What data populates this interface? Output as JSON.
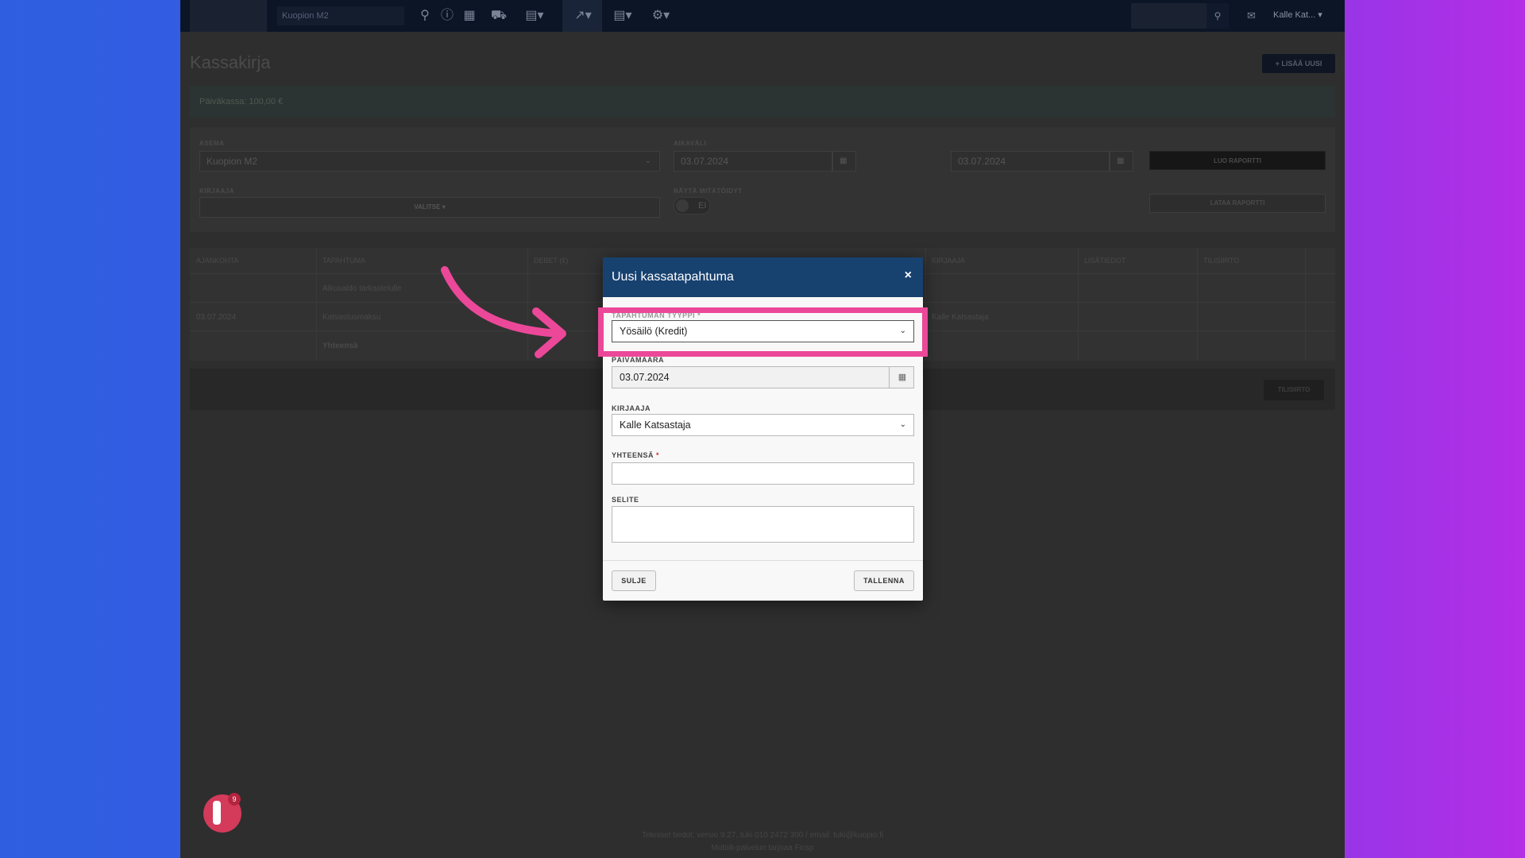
{
  "topbar": {
    "station_value": "Kuopion M2",
    "user_label": "Kalle Kat... ▾"
  },
  "page": {
    "title": "Kassakirja",
    "add_new_label": "+ LISÄÄ UUSI",
    "info_text": "Päiväkassa: 100,00 €"
  },
  "filters": {
    "station_label": "ASEMA",
    "station_value": "Kuopion M2",
    "interval_label": "AIKAVÄLI",
    "date_from": "03.07.2024",
    "date_to": "03.07.2024",
    "recorder_label": "KIRJAAJA",
    "recorder_value": "VALITSE ▾",
    "show_voided_label": "NÄYTÄ MITÄTÖIDYT",
    "show_voided_value": "EI",
    "create_report_label": "LUO RAPORTTI",
    "download_report_label": "LATAA RAPORTTI"
  },
  "table": {
    "headers": [
      "AJANKOHTA",
      "TAPAHTUMA",
      "DEBET (€)",
      "KIRJAAJA",
      "LISÄTIEDOT",
      "TILISIIRTO"
    ],
    "rows": [
      {
        "time": "",
        "event": "Alkusaldo tarkastelulle",
        "debit": "",
        "recorder": ""
      },
      {
        "time": "03.07.2024",
        "event": "Katsastusmaksu",
        "debit": "",
        "recorder": "Kalle Katsastaja"
      },
      {
        "time": "",
        "event": "Yhteensä",
        "debit": "",
        "recorder": ""
      }
    ],
    "footer_button": "TILISIIRTO"
  },
  "footer": {
    "line1": "Tekniset tiedot: versio 9.27, tuki 010 2472 300 / email: tuki@kuopio.fi",
    "line2": "Mobiili-palvelun tarjoaa Ficsp"
  },
  "chat": {
    "badge_count": "9"
  },
  "modal": {
    "title": "Uusi kassatapahtuma",
    "close": "×",
    "type_label": "TAPAHTUMAN TYYPPI *",
    "type_value": "Yösäilö (Kredit)",
    "date_label": "PÄIVÄMÄÄRÄ",
    "date_value": "03.07.2024",
    "recorder_label": "KIRJAAJA",
    "recorder_value": "Kalle Katsastaja",
    "total_label": "YHTEENSÄ",
    "total_required": "*",
    "total_value": "",
    "description_label": "SELITE",
    "close_button": "SULJE",
    "save_button": "TALLENNA"
  },
  "colors": {
    "highlight": "#ec4899",
    "modal_header": "#17416f"
  }
}
